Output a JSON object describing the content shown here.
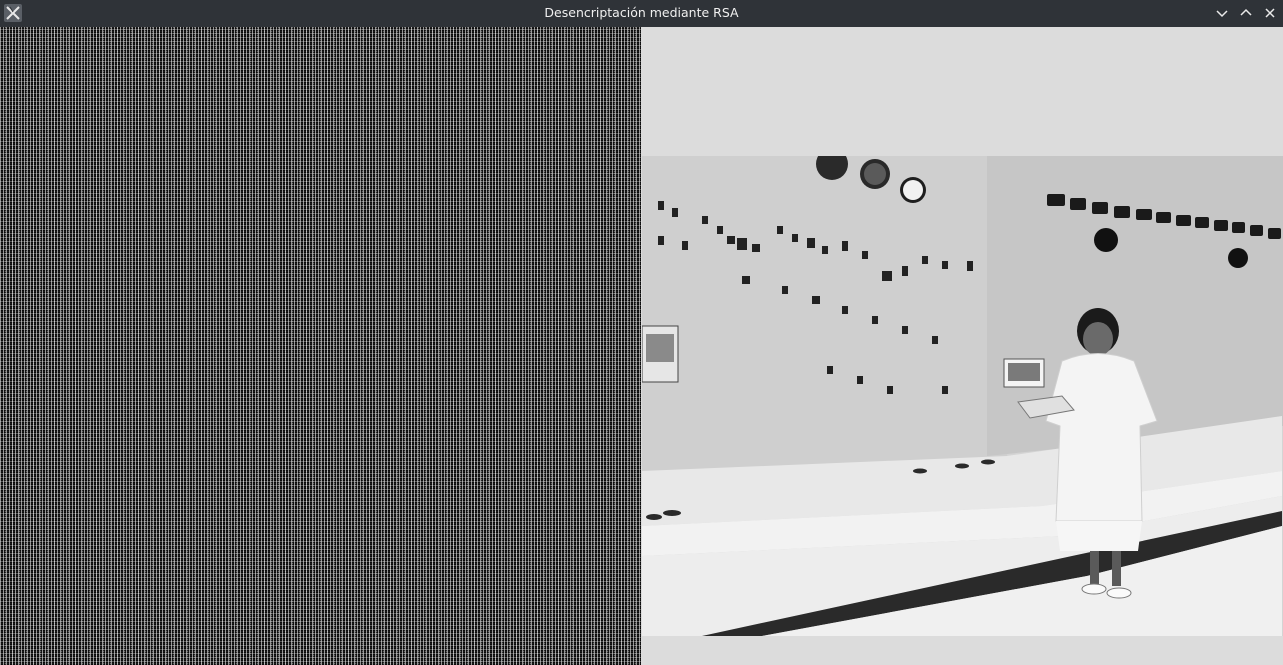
{
  "window": {
    "title": "Desencriptación mediante RSA",
    "app_icon": "x-app-icon",
    "controls": [
      "minimize-icon",
      "maximize-icon",
      "close-icon"
    ]
  },
  "panels": {
    "encrypted_image": {
      "icon": "noise-image"
    },
    "decrypted_image": {
      "icon": "control-room-photo"
    }
  },
  "colors": {
    "titlebar_bg": "#2f3338",
    "window_bg": "#dcdcdc"
  }
}
